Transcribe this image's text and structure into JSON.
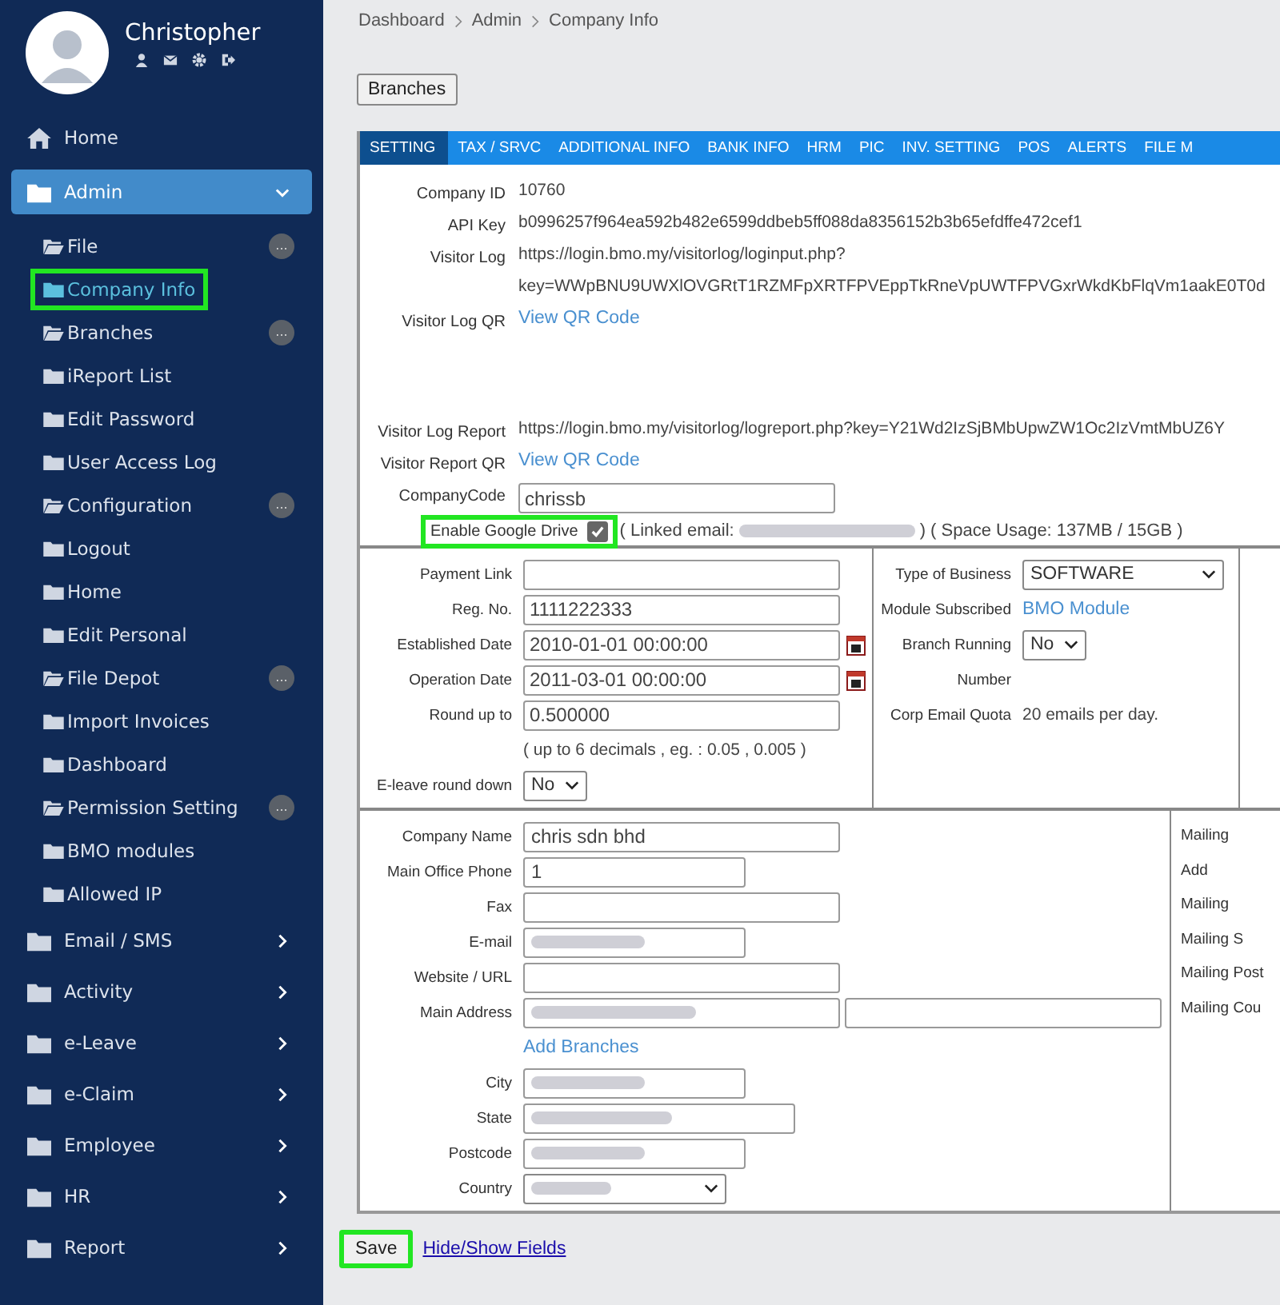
{
  "sidebar": {
    "user_name": "Christopher",
    "nav": [
      {
        "label": "Home",
        "kind": "home",
        "selected": false
      },
      {
        "label": "Admin",
        "kind": "folder",
        "selected": true,
        "expanded": true,
        "children": [
          {
            "label": "File",
            "open": true,
            "selected": false,
            "highlighted": false,
            "badge": "..."
          },
          {
            "label": "Company Info",
            "open": false,
            "selected": true,
            "highlighted": true
          },
          {
            "label": "Branches",
            "open": true,
            "selected": false,
            "highlighted": false,
            "badge": "..."
          },
          {
            "label": "iReport List",
            "open": false,
            "selected": false,
            "highlighted": false
          },
          {
            "label": "Edit Password",
            "open": false,
            "selected": false,
            "highlighted": false
          },
          {
            "label": "User Access Log",
            "open": false,
            "selected": false,
            "highlighted": false
          },
          {
            "label": "Configuration",
            "open": true,
            "selected": false,
            "highlighted": false,
            "badge": "..."
          },
          {
            "label": "Logout",
            "open": false,
            "selected": false,
            "highlighted": false
          },
          {
            "label": "Home",
            "open": false,
            "selected": false,
            "highlighted": false
          },
          {
            "label": "Edit Personal",
            "open": false,
            "selected": false,
            "highlighted": false
          },
          {
            "label": "File Depot",
            "open": true,
            "selected": false,
            "highlighted": false,
            "badge": "..."
          },
          {
            "label": "Import Invoices",
            "open": false,
            "selected": false,
            "highlighted": false
          },
          {
            "label": "Dashboard",
            "open": false,
            "selected": false,
            "highlighted": false
          },
          {
            "label": "Permission Setting",
            "open": true,
            "selected": false,
            "highlighted": false,
            "badge": "..."
          },
          {
            "label": "BMO modules",
            "open": false,
            "selected": false,
            "highlighted": false
          },
          {
            "label": "Allowed IP",
            "open": false,
            "selected": false,
            "highlighted": false
          }
        ]
      },
      {
        "label": "Email / SMS",
        "kind": "folder",
        "selected": false,
        "expanded": false
      },
      {
        "label": "Activity",
        "kind": "folder",
        "selected": false,
        "expanded": false
      },
      {
        "label": "e-Leave",
        "kind": "folder",
        "selected": false,
        "expanded": false
      },
      {
        "label": "e-Claim",
        "kind": "folder",
        "selected": false,
        "expanded": false
      },
      {
        "label": "Employee",
        "kind": "folder",
        "selected": false,
        "expanded": false
      },
      {
        "label": "HR",
        "kind": "folder",
        "selected": false,
        "expanded": false
      },
      {
        "label": "Report",
        "kind": "folder",
        "selected": false,
        "expanded": false
      }
    ]
  },
  "breadcrumb": [
    "Dashboard",
    "Admin",
    "Company Info"
  ],
  "branches_button": "Branches",
  "tabs": [
    {
      "label": "SETTING",
      "selected": true
    },
    {
      "label": "TAX / SRVC",
      "selected": false
    },
    {
      "label": "ADDITIONAL INFO",
      "selected": false
    },
    {
      "label": "BANK INFO",
      "selected": false
    },
    {
      "label": "HRM",
      "selected": false
    },
    {
      "label": "PIC",
      "selected": false
    },
    {
      "label": "INV. SETTING",
      "selected": false
    },
    {
      "label": "POS",
      "selected": false
    },
    {
      "label": "ALERTS",
      "selected": false
    },
    {
      "label": "FILE M",
      "selected": false
    }
  ],
  "settings": [
    {
      "label": "Company ID",
      "kind": "text",
      "value": "10760"
    },
    {
      "label": "API Key",
      "kind": "text",
      "value": "b0996257f964ea592b482e6599ddbeb5ff088da8356152b3b65efdffe472cef1"
    },
    {
      "label": "Visitor Log",
      "kind": "text",
      "value": "https://login.bmo.my/visitorlog/loginput.php?"
    },
    {
      "kind": "text",
      "value": "key=WWpBNU9UWXlOVGRtT1RZMFpXRTFPVEppTkRneVpUWTFPVGxrWkdKbFlqVm1aakE0T0d"
    },
    {
      "label": "Visitor Log QR",
      "kind": "link",
      "value": "View QR Code"
    },
    {
      "kind": "spacer"
    },
    {
      "label": "Visitor Log Report",
      "kind": "text",
      "value": "https://login.bmo.my/visitorlog/logreport.php?key=Y21Wd2IzSjBMbUpwZW1Oc2IzVmtMbUZ6Y"
    },
    {
      "label": "Visitor Report QR",
      "kind": "link",
      "value": "View QR Code"
    },
    {
      "label": "CompanyCode",
      "kind": "input",
      "value": "chrissb"
    }
  ],
  "google_drive": {
    "label": "Enable Google Drive",
    "checked": true,
    "highlighted": true,
    "email_prefix": "( Linked email:",
    "email_blurred": true,
    "usage": ") ( Space Usage: 137MB / 15GB )"
  },
  "left_fields": [
    {
      "label": "Payment Link",
      "kind": "input"
    },
    {
      "label": "Reg. No.",
      "kind": "input",
      "value": "1111222333"
    },
    {
      "label": "Established Date",
      "kind": "date",
      "value": "2010-01-01 00:00:00"
    },
    {
      "label": "Operation Date",
      "kind": "date",
      "value": "2011-03-01 00:00:00"
    },
    {
      "label": "Round up to",
      "kind": "input",
      "value": "0.500000"
    },
    {
      "kind": "note",
      "value": "( up to 6 decimals , eg. : 0.05 , 0.005 )"
    },
    {
      "label": "E-leave round down",
      "kind": "select",
      "value": "No"
    }
  ],
  "middle_fields": [
    {
      "label": "Type of Business",
      "kind": "select-wide",
      "value": "SOFTWARE"
    },
    {
      "label": "Module Subscribed",
      "kind": "link",
      "value": "BMO Module"
    },
    {
      "label": "Branch Running",
      "kind": "select",
      "value": "No"
    },
    {
      "label": "Number",
      "kind": "text"
    },
    {
      "label": "Corp Email Quota",
      "kind": "text",
      "value": "20 emails per day."
    }
  ],
  "address_fields": [
    {
      "label": "Company Name",
      "kind": "input",
      "value": "chris sdn bhd"
    },
    {
      "label": "Main Office Phone",
      "kind": "short-input",
      "value": "1"
    },
    {
      "label": "Fax",
      "kind": "input"
    },
    {
      "label": "E-mail",
      "kind": "short-input",
      "blurred": true
    },
    {
      "label": "Website / URL",
      "kind": "input"
    },
    {
      "label": "Main Address",
      "kind": "address",
      "blurred": true
    },
    {
      "kind": "link",
      "value": "Add Branches"
    },
    {
      "label": "City",
      "kind": "short-input",
      "blurred": true
    },
    {
      "label": "State",
      "kind": "medium-input",
      "blurred": true
    },
    {
      "label": "Postcode",
      "kind": "short-input",
      "blurred": true
    },
    {
      "label": "Country",
      "kind": "select-medium",
      "blurred": true
    }
  ],
  "mailing_labels": [
    "Mailing",
    "Add",
    "Mailing",
    "Mailing S",
    "Mailing Post",
    "Mailing Cou"
  ],
  "save_button": {
    "label": "Save",
    "highlighted": true
  },
  "toggle_link": "Hide/Show Fields"
}
